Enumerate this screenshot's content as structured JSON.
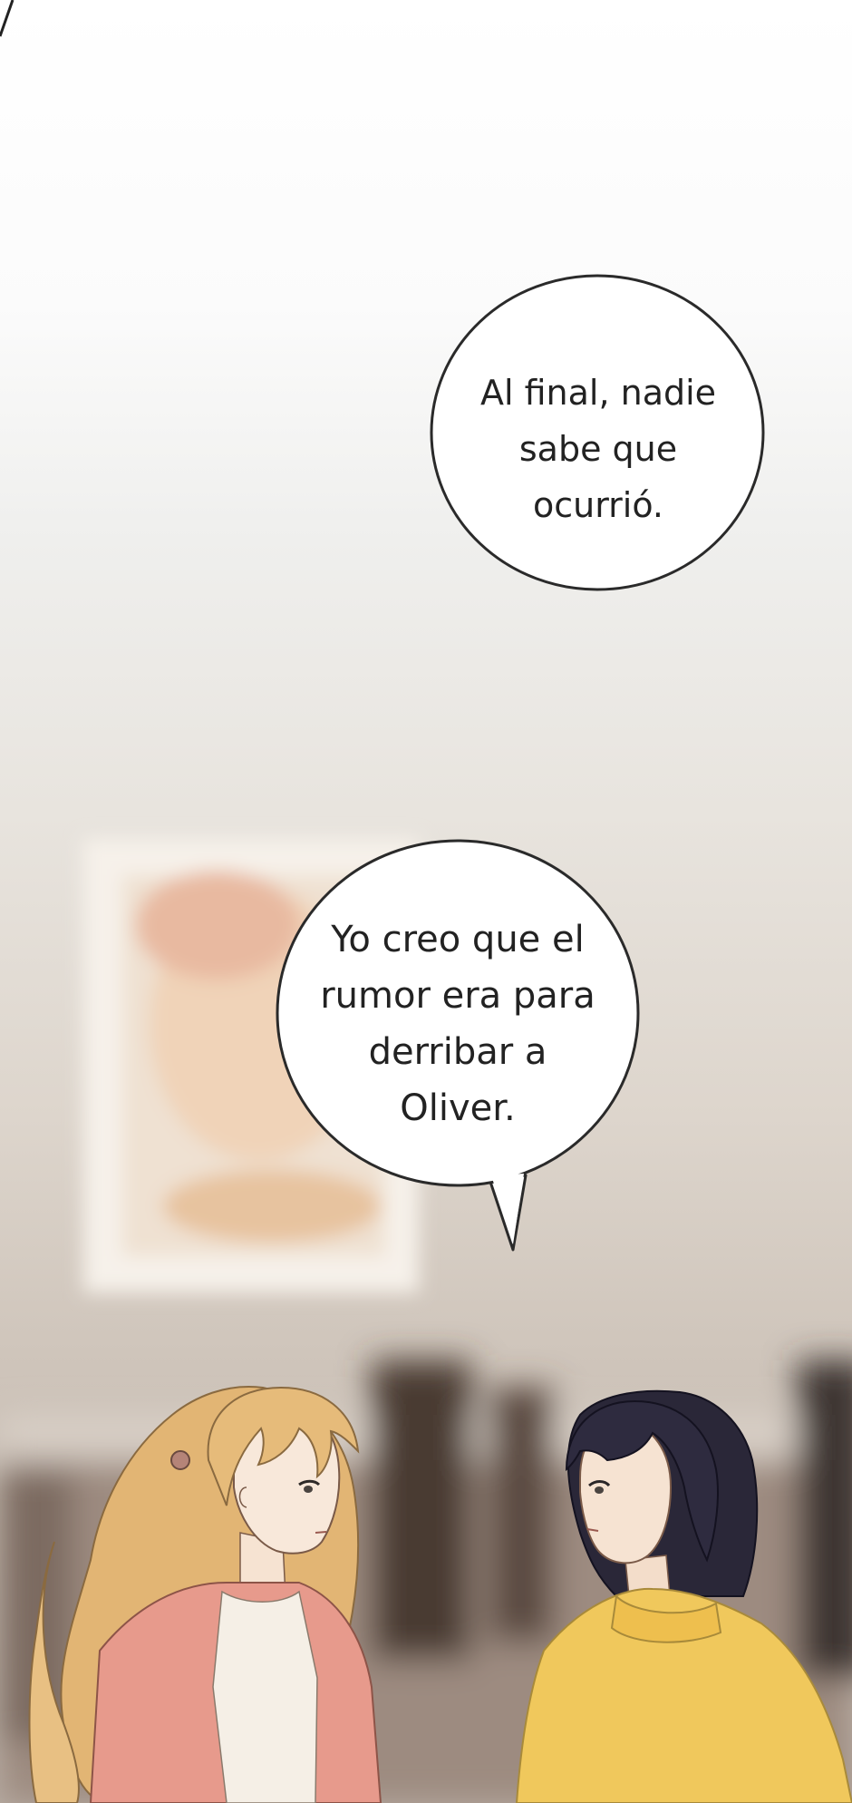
{
  "panel": {
    "bubble_top": {
      "lines": [
        "Al final, nadie",
        "sabe que",
        "ocurrió."
      ]
    },
    "bubble_bottom": {
      "lines": [
        "Yo creo que el",
        "rumor era para",
        "derribar a",
        "Oliver."
      ]
    }
  },
  "colors": {
    "wall": "#e6ded4",
    "frame": "#f4efe9",
    "blonde_cardigan": "#e79a8c",
    "black_hair_sweater": "#f0c85c",
    "dark_hair": "#2a2738",
    "blonde_hair": "#e9be7c"
  }
}
